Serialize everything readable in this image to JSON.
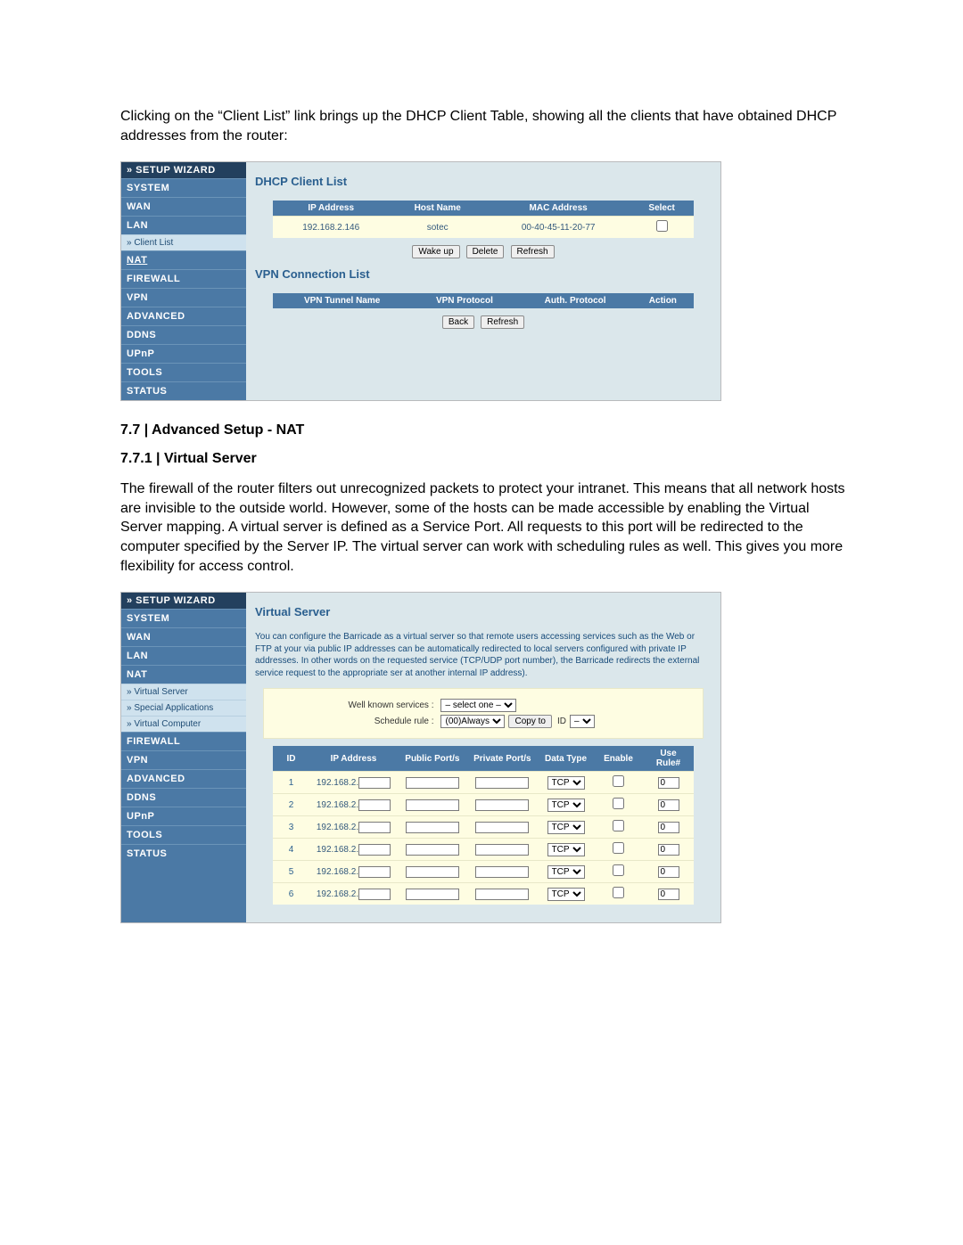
{
  "intro_para": "Clicking on the “Client List” link brings up the DHCP Client Table, showing all the clients that have obtained DHCP addresses from the router:",
  "panel1": {
    "sidebar": {
      "wizard": "» SETUP WIZARD",
      "items": [
        {
          "label": "SYSTEM"
        },
        {
          "label": "WAN"
        },
        {
          "label": "LAN"
        }
      ],
      "subitems1": [
        {
          "label": "» Client List"
        }
      ],
      "items2": [
        {
          "label": "NAT",
          "underline": true
        },
        {
          "label": "FIREWALL"
        },
        {
          "label": "VPN"
        },
        {
          "label": "ADVANCED"
        },
        {
          "label": "DDNS"
        },
        {
          "label": "UPnP"
        },
        {
          "label": "TOOLS"
        },
        {
          "label": "STATUS"
        }
      ]
    },
    "content": {
      "title1": "DHCP Client List",
      "dhcp_table": {
        "headers": [
          "IP Address",
          "Host Name",
          "MAC Address",
          "Select"
        ],
        "rows": [
          {
            "ip": "192.168.2.146",
            "host": "sotec",
            "mac": "00-40-45-11-20-77"
          }
        ]
      },
      "buttons1": [
        "Wake up",
        "Delete",
        "Refresh"
      ],
      "title2": "VPN Connection List",
      "vpn_table": {
        "headers": [
          "VPN Tunnel Name",
          "VPN Protocol",
          "Auth. Protocol",
          "Action"
        ]
      },
      "buttons2": [
        "Back",
        "Refresh"
      ]
    }
  },
  "heading77": "7.7 | Advanced Setup - NAT",
  "heading771": "7.7.1 | Virtual Server",
  "para2": "The firewall of the router filters out unrecognized packets to protect your intranet. This means that all network hosts are invisible to the outside world. However, some of the hosts can be made accessible by enabling the Virtual Server mapping. A virtual server is defined as a Service Port. All requests to this port will be redirected to the computer specified by the Server IP. The virtual server can work with scheduling rules as well. This gives you more flexibility for access control.",
  "panel2": {
    "sidebar": {
      "wizard": "» SETUP WIZARD",
      "items": [
        {
          "label": "SYSTEM"
        },
        {
          "label": "WAN"
        },
        {
          "label": "LAN"
        },
        {
          "label": "NAT"
        }
      ],
      "subitems1": [
        {
          "label": "» Virtual Server"
        },
        {
          "label": "» Special Applications"
        },
        {
          "label": "» Virtual Computer"
        }
      ],
      "items2": [
        {
          "label": "FIREWALL"
        },
        {
          "label": "VPN"
        },
        {
          "label": "ADVANCED"
        },
        {
          "label": "DDNS"
        },
        {
          "label": "UPnP"
        },
        {
          "label": "TOOLS"
        },
        {
          "label": "STATUS"
        }
      ]
    },
    "content": {
      "title": "Virtual Server",
      "help": "You can configure the Barricade as a virtual server so that remote users accessing services such as the Web or FTP at your via public IP addresses can be automatically redirected to local servers configured with private IP addresses. In other words on the requested service (TCP/UDP port number), the Barricade redirects the external service request to the appropriate ser at another internal IP address).",
      "wellknown_label": "Well known services :",
      "wellknown_placeholder": "– select one –",
      "schedule_label": "Schedule rule :",
      "schedule_value": "(00)Always",
      "copy_btn": "Copy to",
      "id_label": "ID",
      "id_value": "–",
      "vs_table": {
        "headers": [
          "ID",
          "IP Address",
          "Public Port/s",
          "Private Port/s",
          "Data Type",
          "Enable",
          "Use Rule#"
        ],
        "ip_prefix": "192.168.2.",
        "datatype_value": "TCP",
        "rule_value": "0",
        "row_ids": [
          "1",
          "2",
          "3",
          "4",
          "5",
          "6"
        ]
      }
    }
  }
}
